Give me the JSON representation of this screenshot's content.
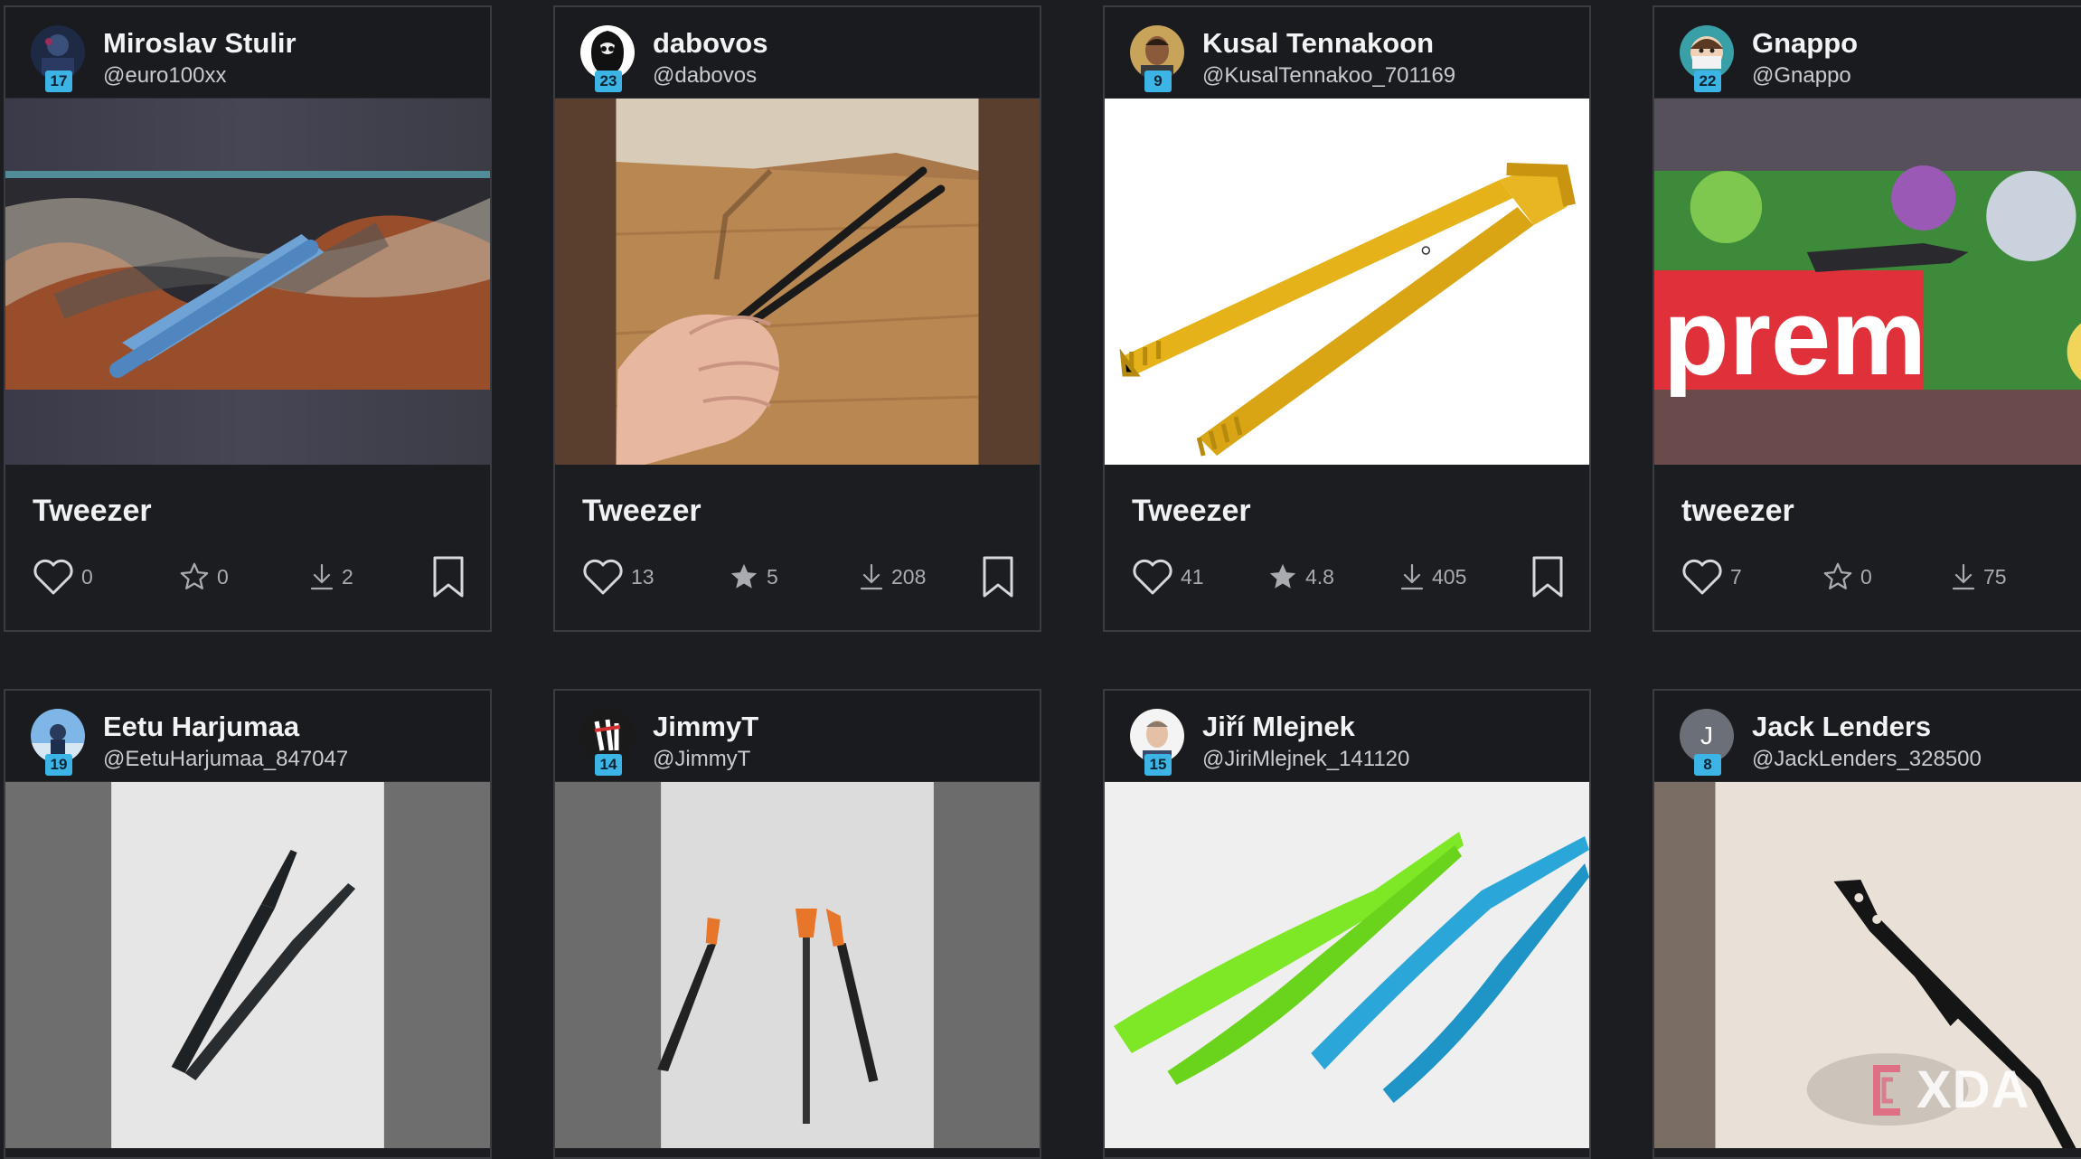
{
  "cards": [
    {
      "name": "Miroslav Stulir",
      "handle": "@euro100xx",
      "level": "17",
      "title": "Tweezer",
      "likes": "0",
      "rating": "0",
      "downloads": "2"
    },
    {
      "name": "dabovos",
      "handle": "@dabovos",
      "level": "23",
      "title": "Tweezer",
      "likes": "13",
      "rating": "5",
      "downloads": "208"
    },
    {
      "name": "Kusal Tennakoon",
      "handle": "@KusalTennakoo_701169",
      "level": "9",
      "title": "Tweezer",
      "likes": "41",
      "rating": "4.8",
      "downloads": "405"
    },
    {
      "name": "Gnappo",
      "handle": "@Gnappo",
      "level": "22",
      "title": "tweezer",
      "likes": "7",
      "rating": "0",
      "downloads": "75"
    },
    {
      "name": "Eetu Harjumaa",
      "handle": "@EetuHarjumaa_847047",
      "level": "19"
    },
    {
      "name": "JimmyT",
      "handle": "@JimmyT",
      "level": "14"
    },
    {
      "name": "Jiří Mlejnek",
      "handle": "@JiriMlejnek_141120",
      "level": "15"
    },
    {
      "name": "Jack Lenders",
      "handle": "@JackLenders_328500",
      "level": "8",
      "avatar_letter": "J"
    }
  ],
  "watermark": "XDA",
  "colors": {
    "accent": "#3cb4e6",
    "background": "#1c1d21",
    "border": "#3a3c42"
  }
}
